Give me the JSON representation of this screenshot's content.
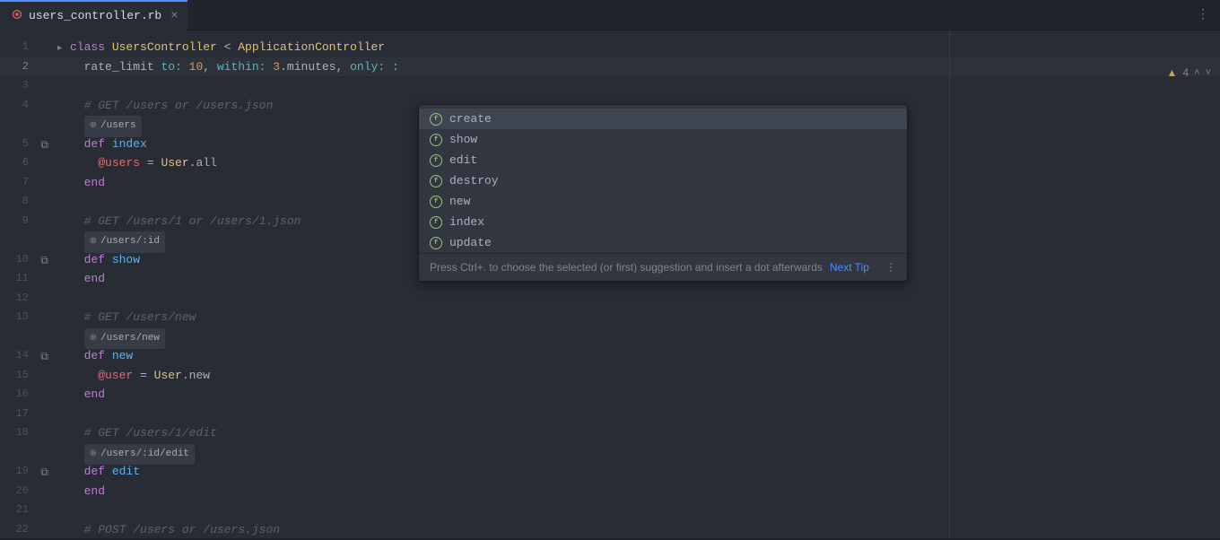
{
  "tab": {
    "filename": "users_controller.rb"
  },
  "status": {
    "warnings": 4
  },
  "autocomplete": {
    "items": [
      "create",
      "show",
      "edit",
      "destroy",
      "new",
      "index",
      "update"
    ],
    "footer_hint": "Press Ctrl+. to choose the selected (or first) suggestion and insert a dot afterwards",
    "next_tip": "Next Tip"
  },
  "routes": {
    "index": "/users",
    "show": "/users/:id",
    "new": "/users/new",
    "edit": "/users/:id/edit"
  },
  "code": {
    "lines": [
      {
        "n": 1,
        "indent": 0,
        "segs": [
          {
            "c": "kw",
            "t": "class "
          },
          {
            "c": "cls",
            "t": "UsersController"
          },
          {
            "c": "txt",
            "t": " < "
          },
          {
            "c": "cls",
            "t": "ApplicationController"
          }
        ],
        "fold": true
      },
      {
        "n": 2,
        "indent": 1,
        "hl": true,
        "segs": [
          {
            "c": "txt",
            "t": "rate_limit "
          },
          {
            "c": "sym",
            "t": "to: "
          },
          {
            "c": "num",
            "t": "10"
          },
          {
            "c": "txt",
            "t": ", "
          },
          {
            "c": "sym",
            "t": "within: "
          },
          {
            "c": "num",
            "t": "3"
          },
          {
            "c": "txt",
            "t": ".minutes, "
          },
          {
            "c": "sym",
            "t": "only: "
          },
          {
            "c": "sym",
            "t": ":"
          }
        ]
      },
      {
        "n": 3,
        "indent": 0,
        "segs": []
      },
      {
        "n": 4,
        "indent": 1,
        "segs": [
          {
            "c": "comment",
            "t": "# GET /users or /users.json"
          }
        ]
      },
      {
        "n": "",
        "indent": 1,
        "route": "index"
      },
      {
        "n": 5,
        "indent": 1,
        "icon": "copy",
        "segs": [
          {
            "c": "kw",
            "t": "def "
          },
          {
            "c": "def",
            "t": "index"
          }
        ]
      },
      {
        "n": 6,
        "indent": 2,
        "segs": [
          {
            "c": "ivar",
            "t": "@users"
          },
          {
            "c": "txt",
            "t": " = "
          },
          {
            "c": "cls",
            "t": "User"
          },
          {
            "c": "txt",
            "t": ".all"
          }
        ]
      },
      {
        "n": 7,
        "indent": 1,
        "segs": [
          {
            "c": "kw",
            "t": "end"
          }
        ]
      },
      {
        "n": 8,
        "indent": 0,
        "segs": []
      },
      {
        "n": 9,
        "indent": 1,
        "segs": [
          {
            "c": "comment",
            "t": "# GET /users/1 or /users/1.json"
          }
        ]
      },
      {
        "n": "",
        "indent": 1,
        "route": "show"
      },
      {
        "n": 10,
        "indent": 1,
        "icon": "copy",
        "segs": [
          {
            "c": "kw",
            "t": "def "
          },
          {
            "c": "def",
            "t": "show"
          }
        ]
      },
      {
        "n": 11,
        "indent": 1,
        "segs": [
          {
            "c": "kw",
            "t": "end"
          }
        ]
      },
      {
        "n": 12,
        "indent": 0,
        "segs": []
      },
      {
        "n": 13,
        "indent": 1,
        "segs": [
          {
            "c": "comment",
            "t": "# GET /users/new"
          }
        ]
      },
      {
        "n": "",
        "indent": 1,
        "route": "new"
      },
      {
        "n": 14,
        "indent": 1,
        "icon": "copy",
        "segs": [
          {
            "c": "kw",
            "t": "def "
          },
          {
            "c": "def",
            "t": "new"
          }
        ]
      },
      {
        "n": 15,
        "indent": 2,
        "segs": [
          {
            "c": "ivar",
            "t": "@user"
          },
          {
            "c": "txt",
            "t": " = "
          },
          {
            "c": "cls",
            "t": "User"
          },
          {
            "c": "txt",
            "t": ".new"
          }
        ]
      },
      {
        "n": 16,
        "indent": 1,
        "segs": [
          {
            "c": "kw",
            "t": "end"
          }
        ]
      },
      {
        "n": 17,
        "indent": 0,
        "segs": []
      },
      {
        "n": 18,
        "indent": 1,
        "segs": [
          {
            "c": "comment",
            "t": "# GET /users/1/edit"
          }
        ]
      },
      {
        "n": "",
        "indent": 1,
        "route": "edit"
      },
      {
        "n": 19,
        "indent": 1,
        "icon": "copy",
        "segs": [
          {
            "c": "kw",
            "t": "def "
          },
          {
            "c": "def",
            "t": "edit"
          }
        ]
      },
      {
        "n": 20,
        "indent": 1,
        "segs": [
          {
            "c": "kw",
            "t": "end"
          }
        ]
      },
      {
        "n": 21,
        "indent": 0,
        "segs": []
      },
      {
        "n": 22,
        "indent": 1,
        "segs": [
          {
            "c": "comment",
            "t": "# POST /users or /users.json"
          }
        ]
      }
    ]
  }
}
